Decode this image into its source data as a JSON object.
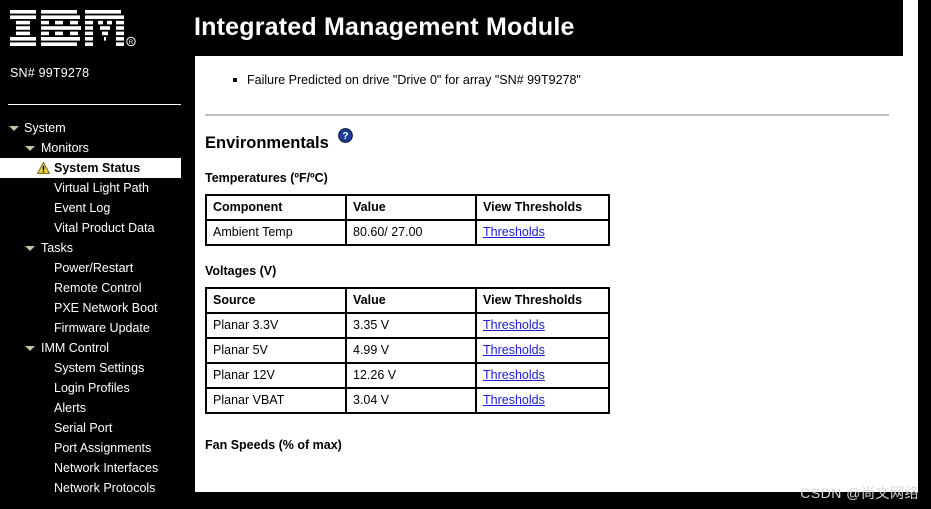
{
  "header": {
    "title": "Integrated Management Module"
  },
  "sidebar": {
    "logo_alt": "IBM",
    "registered_mark": "®",
    "serial": "SN# 99T9278",
    "tree": [
      {
        "label": "System",
        "depth": 0,
        "caret": "chevron-down-icon",
        "selected": false,
        "icon": null
      },
      {
        "label": "Monitors",
        "depth": 1,
        "caret": "chevron-down-icon",
        "selected": false,
        "icon": null
      },
      {
        "label": "System Status",
        "depth": 2,
        "caret": null,
        "selected": true,
        "icon": "warning-icon"
      },
      {
        "label": "Virtual Light Path",
        "depth": 2,
        "caret": null,
        "selected": false,
        "icon": null
      },
      {
        "label": "Event Log",
        "depth": 2,
        "caret": null,
        "selected": false,
        "icon": null
      },
      {
        "label": "Vital Product Data",
        "depth": 2,
        "caret": null,
        "selected": false,
        "icon": null
      },
      {
        "label": "Tasks",
        "depth": 1,
        "caret": "chevron-down-icon",
        "selected": false,
        "icon": null
      },
      {
        "label": "Power/Restart",
        "depth": 2,
        "caret": null,
        "selected": false,
        "icon": null
      },
      {
        "label": "Remote Control",
        "depth": 2,
        "caret": null,
        "selected": false,
        "icon": null
      },
      {
        "label": "PXE Network Boot",
        "depth": 2,
        "caret": null,
        "selected": false,
        "icon": null
      },
      {
        "label": "Firmware Update",
        "depth": 2,
        "caret": null,
        "selected": false,
        "icon": null
      },
      {
        "label": "IMM Control",
        "depth": 1,
        "caret": "chevron-down-icon",
        "selected": false,
        "icon": null
      },
      {
        "label": "System Settings",
        "depth": 2,
        "caret": null,
        "selected": false,
        "icon": null
      },
      {
        "label": "Login Profiles",
        "depth": 2,
        "caret": null,
        "selected": false,
        "icon": null
      },
      {
        "label": "Alerts",
        "depth": 2,
        "caret": null,
        "selected": false,
        "icon": null
      },
      {
        "label": "Serial Port",
        "depth": 2,
        "caret": null,
        "selected": false,
        "icon": null
      },
      {
        "label": "Port Assignments",
        "depth": 2,
        "caret": null,
        "selected": false,
        "icon": null
      },
      {
        "label": "Network Interfaces",
        "depth": 2,
        "caret": null,
        "selected": false,
        "icon": null
      },
      {
        "label": "Network Protocols",
        "depth": 2,
        "caret": null,
        "selected": false,
        "icon": null
      }
    ]
  },
  "main": {
    "alerts": [
      "Failure Predicted on drive \"Drive 0\" for array \"SN# 99T9278\""
    ],
    "environmentals": {
      "heading": "Environmentals",
      "help_icon": "help-question-icon",
      "temperatures": {
        "label": "Temperatures (ºF/ºC)",
        "columns": [
          "Component",
          "Value",
          "View Thresholds"
        ],
        "rows": [
          {
            "component": "Ambient Temp",
            "value": "80.60/ 27.00",
            "link": "Thresholds"
          }
        ]
      },
      "voltages": {
        "label": "Voltages (V)",
        "columns": [
          "Source",
          "Value",
          "View Thresholds"
        ],
        "rows": [
          {
            "component": "Planar 3.3V",
            "value": "3.35 V",
            "link": "Thresholds"
          },
          {
            "component": "Planar 5V",
            "value": "4.99 V",
            "link": "Thresholds"
          },
          {
            "component": "Planar 12V",
            "value": "12.26 V",
            "link": "Thresholds"
          },
          {
            "component": "Planar VBAT",
            "value": "3.04 V",
            "link": "Thresholds"
          }
        ]
      },
      "fan_speeds": {
        "label": "Fan Speeds (% of max)"
      }
    }
  },
  "watermark": "CSDN @尚文网络",
  "colors": {
    "background": "#000000",
    "panel": "#ffffff",
    "link": "#1a1ad0",
    "caret": "#c9c2a4",
    "warning": "#e8d24a",
    "help": "#1b3f9b"
  }
}
